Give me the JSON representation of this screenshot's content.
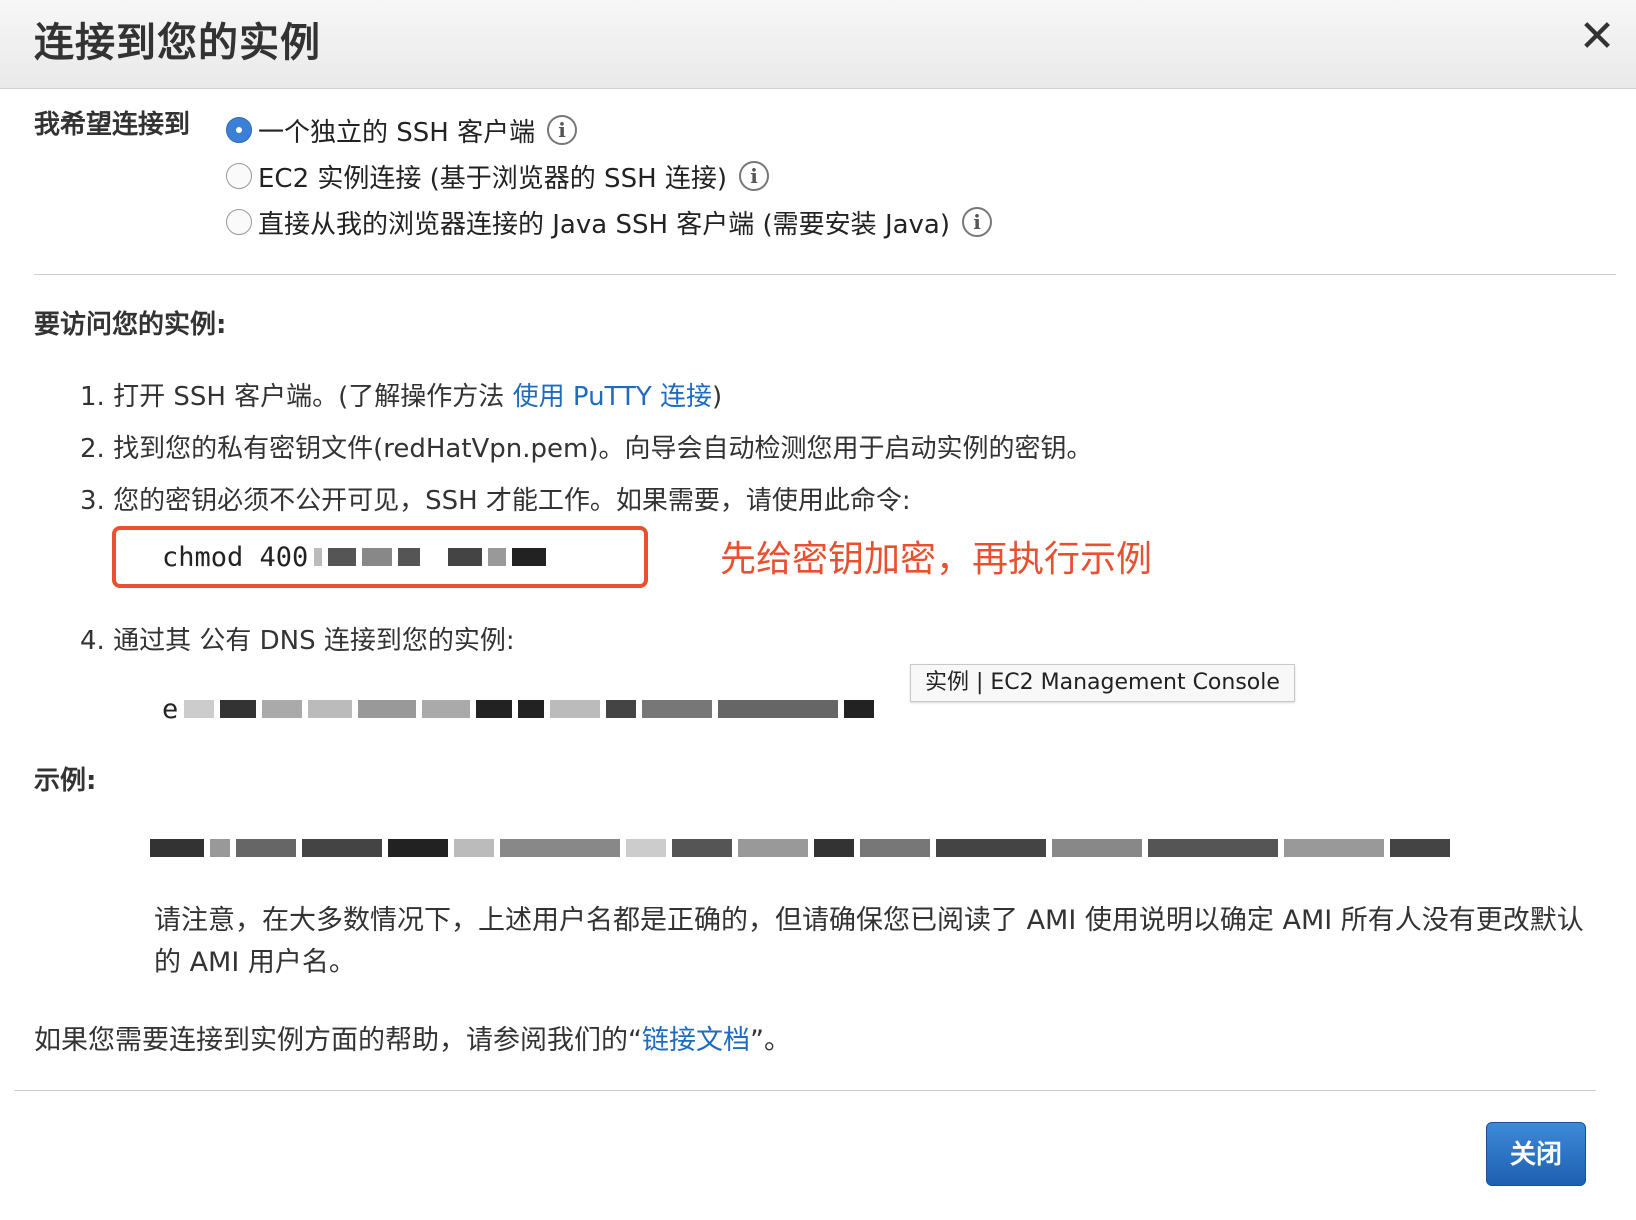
{
  "dialog": {
    "title": "连接到您的实例",
    "close_icon": "close-icon"
  },
  "connect_option": {
    "label": "我希望连接到",
    "options": [
      {
        "label": "一个独立的 SSH 客户端",
        "selected": true
      },
      {
        "label": "EC2 实例连接 (基于浏览器的 SSH 连接)",
        "selected": false
      },
      {
        "label": "直接从我的浏览器连接的 Java SSH 客户端 (需要安装 Java)",
        "selected": false
      }
    ],
    "info_glyph": "i"
  },
  "access": {
    "heading": "要访问您的实例:",
    "step1_prefix": "1. 打开 SSH 客户端。(了解操作方法 ",
    "step1_link": "使用 PuTTY 连接",
    "step1_suffix": ")",
    "step2": "2. 找到您的私有密钥文件(redHatVpn.pem)。向导会自动检测您用于启动实例的密钥。",
    "step3": "3. 您的密钥必须不公开可见，SSH 才能工作。如果需要，请使用此命令:",
    "command_prefix": "chmod 400",
    "annotation": "先给密钥加密，再执行示例",
    "step4": "4. 通过其 公有 DNS 连接到您的实例:",
    "dns_prefix": "e",
    "tooltip": "实例 | EC2 Management Console"
  },
  "example": {
    "heading": "示例:",
    "note": "请注意，在大多数情况下，上述用户名都是正确的，但请确保您已阅读了 AMI 使用说明以确定 AMI 所有人没有更改默认的 AMI 用户名。"
  },
  "help": {
    "prefix": "如果您需要连接到实例方面的帮助，请参阅我们的“",
    "link": "链接文档",
    "suffix": "”。"
  },
  "footer": {
    "close_label": "关闭"
  },
  "colors": {
    "accent_link": "#1f6bbf",
    "annotation_red": "#e8502f",
    "button_blue": "#2b6bbd"
  }
}
